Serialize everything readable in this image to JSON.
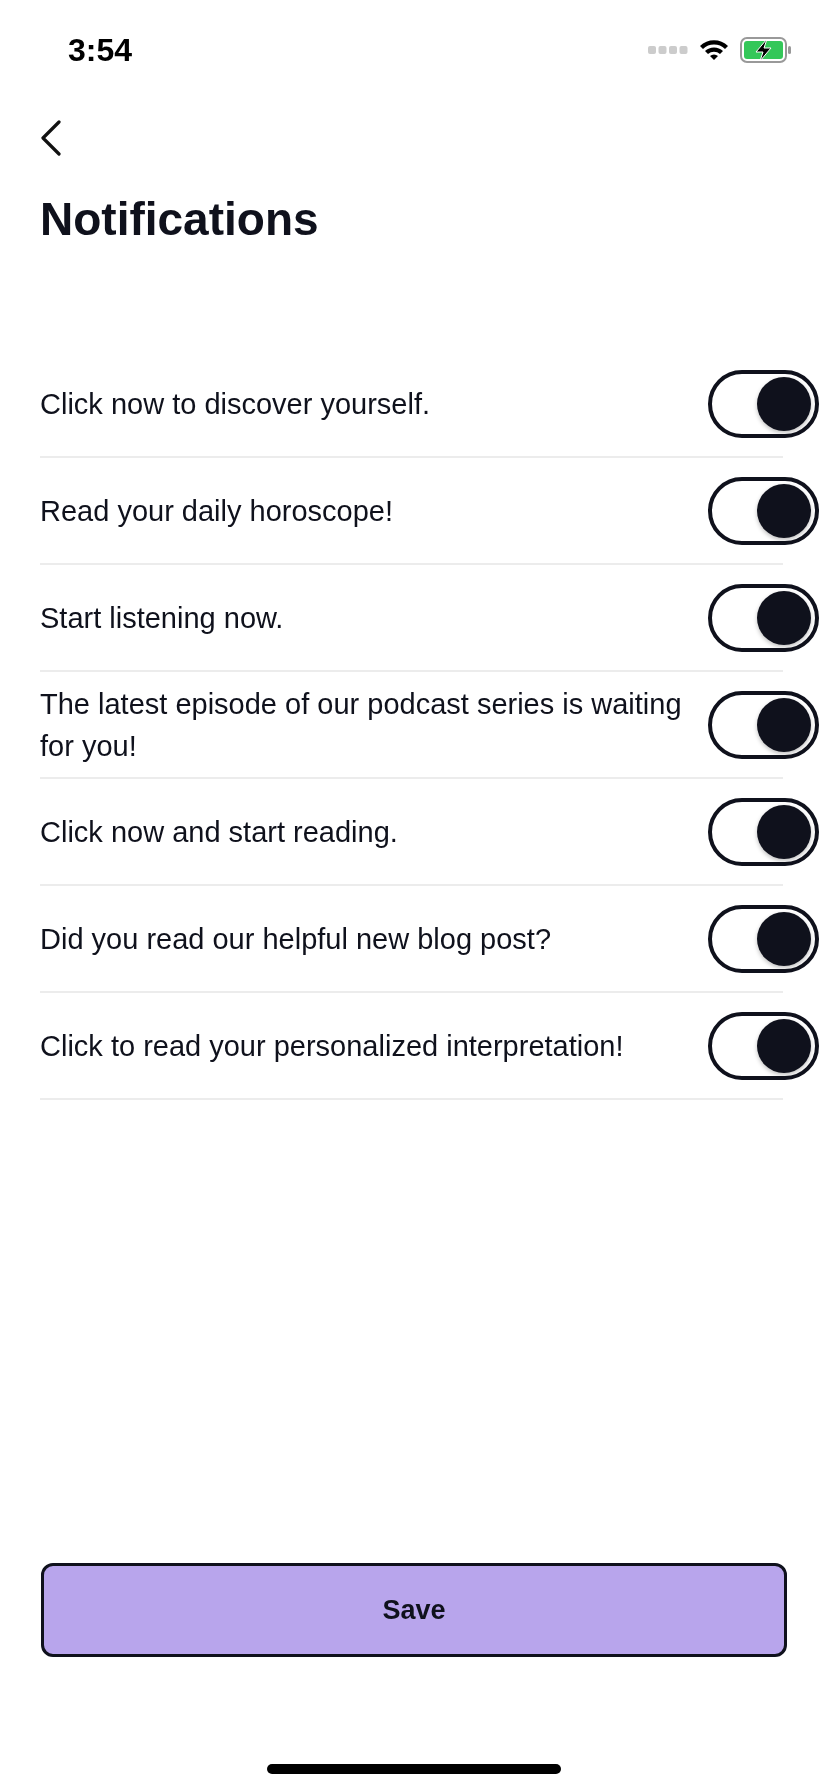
{
  "status_bar": {
    "time": "3:54"
  },
  "title": "Notifications",
  "settings": [
    {
      "label": "Click now to discover yourself.",
      "on": true
    },
    {
      "label": "Read your daily horoscope!",
      "on": true
    },
    {
      "label": "Start listening now.",
      "on": true
    },
    {
      "label": "The latest episode of our podcast series is waiting for you!",
      "on": true
    },
    {
      "label": "Click now and start reading.",
      "on": true
    },
    {
      "label": "Did you read our helpful new blog post?",
      "on": true
    },
    {
      "label": "Click to read your personalized interpretation!",
      "on": true
    }
  ],
  "save_button": "Save"
}
